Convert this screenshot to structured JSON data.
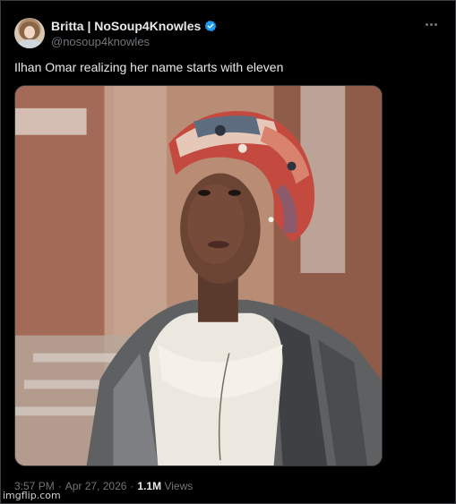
{
  "author": {
    "display_name": "Britta | NoSoup4Knowles",
    "handle": "@nosoup4knowles",
    "verified": true
  },
  "tweet": {
    "text": "Ilhan Omar realizing her name starts with eleven"
  },
  "meta": {
    "time": "3:57 PM",
    "separator1": "·",
    "date": "Apr 27, 2026",
    "separator2": "·",
    "views_count": "1.1M",
    "views_label": "Views"
  },
  "watermark": "imgflip.com",
  "colors": {
    "background": "#000000",
    "text_primary": "#e7e9ea",
    "text_secondary": "#71767b",
    "verified": "#1d9bf0"
  },
  "icons": {
    "verified": "verified-badge-icon",
    "more": "more-options-icon"
  }
}
